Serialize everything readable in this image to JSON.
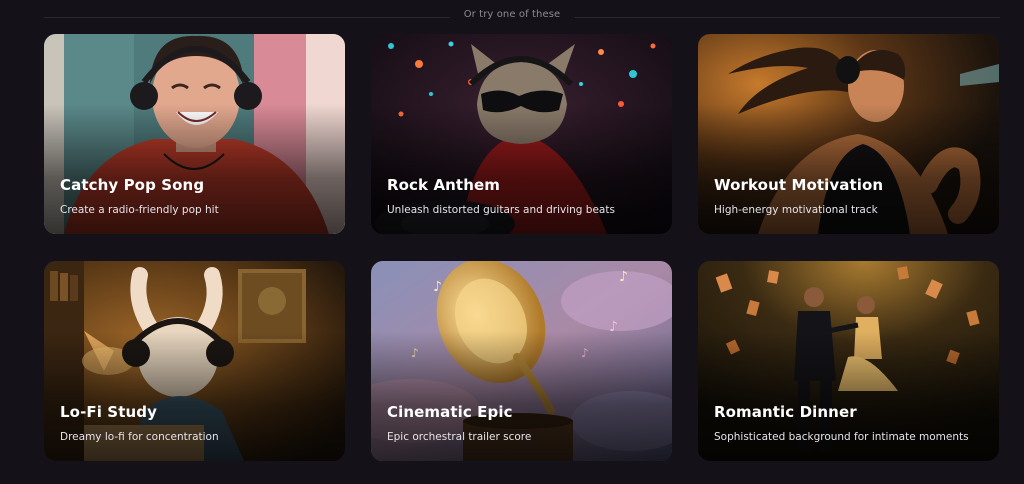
{
  "header": {
    "divider_text": "Or try one of these"
  },
  "cards": [
    {
      "title": "Catchy Pop Song",
      "description": "Create a radio-friendly pop hit",
      "image": "smiling-person-with-headphones"
    },
    {
      "title": "Rock Anthem",
      "description": "Unleash distorted guitars and driving beats",
      "image": "cat-dj-in-red-hoodie"
    },
    {
      "title": "Workout Motivation",
      "description": "High-energy motivational track",
      "image": "woman-running-with-headphones"
    },
    {
      "title": "Lo-Fi Study",
      "description": "Dreamy lo-fi for concentration",
      "image": "bunny-studying-with-headphones"
    },
    {
      "title": "Cinematic Epic",
      "description": "Epic orchestral trailer score",
      "image": "gramophone-in-clouds"
    },
    {
      "title": "Romantic Dinner",
      "description": "Sophisticated background for intimate moments",
      "image": "couple-dancing-in-spotlight"
    }
  ]
}
